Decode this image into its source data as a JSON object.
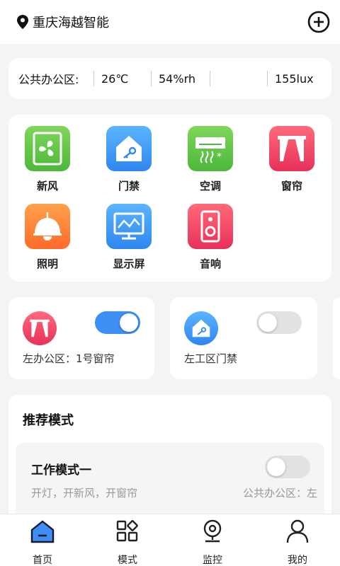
{
  "header": {
    "location": "重庆海越智能",
    "location_icon": "location-pin-icon",
    "add_icon": "plus-circle-icon"
  },
  "environment": {
    "area": "公共办公区:",
    "temperature": "26℃",
    "humidity": "54%rh",
    "empty": "",
    "illuminance": "155lux"
  },
  "devices": [
    {
      "label": "新风",
      "icon": "fan-icon",
      "color": "#4cb83a"
    },
    {
      "label": "门禁",
      "icon": "door-key-icon",
      "color": "#2f86ee"
    },
    {
      "label": "空调",
      "icon": "air-conditioner-icon",
      "color": "#4cb83a"
    },
    {
      "label": "窗帘",
      "icon": "curtain-icon",
      "color": "#e8305a"
    },
    {
      "label": "照明",
      "icon": "lamp-icon",
      "color": "#ff6a2a"
    },
    {
      "label": "显示屏",
      "icon": "monitor-icon",
      "color": "#2f86ee"
    },
    {
      "label": "音响",
      "icon": "speaker-icon",
      "color": "#e8305a"
    }
  ],
  "quick_controls": [
    {
      "label": "左办公区：1号窗帘",
      "icon": "curtain-icon",
      "on": true
    },
    {
      "label": "左工区门禁",
      "icon": "door-key-icon",
      "on": false
    }
  ],
  "modes": {
    "title": "推荐模式",
    "items": [
      {
        "name": "工作模式一",
        "desc": "开灯，开新风，开窗帘",
        "area": "公共办公区：左",
        "on": false
      }
    ]
  },
  "tabbar": [
    {
      "label": "首页",
      "icon": "home-icon",
      "active": true
    },
    {
      "label": "模式",
      "icon": "modes-icon",
      "active": false
    },
    {
      "label": "监控",
      "icon": "camera-icon",
      "active": false
    },
    {
      "label": "我的",
      "icon": "user-icon",
      "active": false
    }
  ],
  "colors": {
    "accent": "#3d8ef5",
    "background": "#f3f4f6"
  }
}
